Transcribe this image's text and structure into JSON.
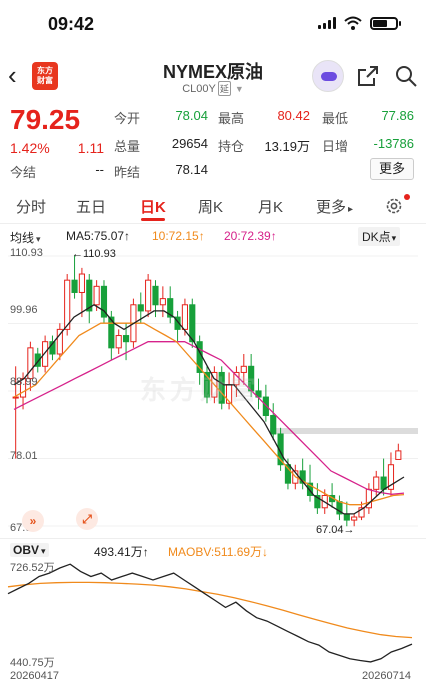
{
  "status": {
    "time": "09:42"
  },
  "nav": {
    "back_glyph": "‹",
    "logo_text_1": "东方",
    "logo_text_2": "财富",
    "title": "NYMEX原油",
    "code": "CL00Y",
    "delay_tag": "延",
    "icons": [
      "back-icon",
      "share-icon",
      "search-icon"
    ]
  },
  "quote": {
    "price": "79.25",
    "change_pct": "1.42%",
    "change": "1.11",
    "fields": [
      {
        "label": "今开",
        "value": "78.04",
        "color": "green"
      },
      {
        "label": "最高",
        "value": "80.42",
        "color": "red"
      },
      {
        "label": "最低",
        "value": "77.86",
        "color": "green"
      },
      {
        "label": "总量",
        "value": "29654",
        "color": "dark"
      },
      {
        "label": "持仓",
        "value": "13.19万",
        "color": "dark"
      },
      {
        "label": "日增",
        "value": "-13786",
        "color": "green"
      },
      {
        "label": "今结",
        "value": "--",
        "color": "dark"
      },
      {
        "label": "昨结",
        "value": "78.14",
        "color": "dark"
      }
    ],
    "more_label": "更多",
    "colors": {
      "up": "#e5231c",
      "down": "#17a03a"
    }
  },
  "tabs": {
    "items": [
      "分时",
      "五日",
      "日K",
      "周K",
      "月K",
      "更多"
    ],
    "active": "日K",
    "more_caret": "▸"
  },
  "indicators": {
    "selector": "均线",
    "ma5": "MA5:75.07↑",
    "ma10": "10:72.15↑",
    "ma20": "20:72.39↑",
    "dk_label": "DK点",
    "colors": {
      "ma5": "#222222",
      "ma10": "#f08a1c",
      "ma20": "#d6228b"
    }
  },
  "kchart": {
    "y_ticks": [
      "110.93",
      "99.96",
      "88.99",
      "78.01",
      "67.04"
    ],
    "high_label": "←110.93",
    "low_label": "67.04→",
    "watermark": "东方财富",
    "ylim": [
      67.04,
      110.93
    ]
  },
  "chart_data": {
    "type": "candlestick",
    "ylim": [
      67.04,
      110.93
    ],
    "x_start": "20260417",
    "x_end": "20260714",
    "candles": [
      [
        88,
        93,
        78,
        88
      ],
      [
        88,
        92,
        86,
        91
      ],
      [
        91,
        97,
        89,
        96
      ],
      [
        95,
        96,
        92,
        93
      ],
      [
        93,
        98,
        92,
        97
      ],
      [
        97,
        98,
        94,
        95
      ],
      [
        95,
        100,
        94,
        99
      ],
      [
        99,
        108,
        98,
        107
      ],
      [
        107,
        111,
        104,
        105
      ],
      [
        105,
        109,
        101,
        108
      ],
      [
        107,
        108,
        100,
        102
      ],
      [
        103,
        107,
        102,
        106
      ],
      [
        106,
        107,
        100,
        101
      ],
      [
        101,
        102,
        94,
        96
      ],
      [
        96,
        99,
        95,
        98
      ],
      [
        98,
        100,
        94,
        97
      ],
      [
        97,
        104,
        96,
        103
      ],
      [
        103,
        105,
        100,
        102
      ],
      [
        102,
        108,
        101,
        107
      ],
      [
        106,
        107,
        101,
        103
      ],
      [
        103,
        106,
        101,
        104
      ],
      [
        104,
        106,
        100,
        101
      ],
      [
        101,
        102,
        97,
        99
      ],
      [
        99,
        104,
        98,
        103
      ],
      [
        103,
        104,
        96,
        97
      ],
      [
        97,
        98,
        90,
        92
      ],
      [
        92,
        93,
        87,
        88
      ],
      [
        88,
        93,
        87,
        92
      ],
      [
        92,
        93,
        86,
        87
      ],
      [
        87,
        92,
        86,
        90
      ],
      [
        90,
        93,
        88,
        92
      ],
      [
        92,
        95,
        90,
        93
      ],
      [
        93,
        95,
        88,
        89
      ],
      [
        89,
        91,
        86,
        88
      ],
      [
        88,
        90,
        84,
        85
      ],
      [
        85,
        87,
        81,
        82
      ],
      [
        82,
        83,
        76,
        77
      ],
      [
        77,
        78,
        73,
        74
      ],
      [
        74,
        77,
        73,
        76
      ],
      [
        76,
        78,
        73,
        74
      ],
      [
        74,
        77,
        71,
        72
      ],
      [
        72,
        74,
        69,
        70
      ],
      [
        70,
        73,
        69,
        72
      ],
      [
        72,
        74,
        70,
        71
      ],
      [
        71,
        72,
        68,
        69
      ],
      [
        69,
        71,
        67,
        68
      ],
      [
        68,
        69,
        67,
        68.5
      ],
      [
        68.5,
        71,
        68,
        70
      ],
      [
        70,
        74,
        69,
        73
      ],
      [
        73,
        76,
        72,
        75
      ],
      [
        75,
        78,
        72,
        73
      ],
      [
        73,
        79,
        72,
        77
      ],
      [
        77.86,
        80.42,
        77.86,
        79.25
      ]
    ],
    "ma5_line": [
      90,
      91,
      93,
      95,
      97,
      99,
      101,
      102,
      103,
      102,
      100,
      99,
      100,
      101,
      102,
      102,
      101,
      99,
      97,
      94,
      91,
      90,
      90,
      88,
      86,
      84,
      81,
      78,
      76,
      74,
      72,
      71,
      70,
      69,
      69,
      70,
      71.5,
      73,
      74,
      75
    ],
    "ma10_line": [
      88,
      89,
      90,
      92,
      94,
      96,
      98,
      99,
      100,
      100,
      100,
      100,
      100,
      99,
      98,
      97,
      95,
      93,
      91,
      89,
      87,
      85,
      83,
      81,
      79,
      77,
      75,
      74,
      73,
      72,
      71,
      70.5,
      70.5,
      71,
      71.5,
      72,
      72.15
    ],
    "ma20_line": [
      86,
      87,
      88,
      89,
      90,
      91,
      92,
      93,
      94,
      95,
      96,
      97,
      97,
      97,
      97,
      96,
      95,
      94,
      92,
      90,
      88,
      86,
      84,
      82,
      80,
      78,
      76,
      75,
      74,
      73,
      72.5,
      72.2,
      72.39
    ],
    "obv": {
      "label": "OBV",
      "value": "493.41万↑",
      "maobv_label": "MAOBV:511.69万↓",
      "y_ticks": [
        "726.52万",
        "440.75万"
      ],
      "ylim": [
        440.75,
        726.52
      ],
      "obv_line": [
        640,
        655,
        670,
        690,
        700,
        715,
        726,
        705,
        690,
        700,
        680,
        690,
        700,
        690,
        680,
        690,
        700,
        680,
        660,
        640,
        620,
        600,
        615,
        590,
        570,
        560,
        545,
        530,
        515,
        500,
        490,
        470,
        460,
        450,
        445,
        441,
        450,
        470,
        480,
        493
      ],
      "maobv_line": [
        660,
        666,
        670,
        672,
        673,
        673,
        672,
        670,
        668,
        665,
        660,
        654,
        646,
        638,
        628,
        617,
        605,
        592,
        578,
        565,
        552,
        540,
        530,
        521,
        515,
        512
      ]
    }
  },
  "dates": {
    "start": "20260417",
    "end": "20260714"
  }
}
